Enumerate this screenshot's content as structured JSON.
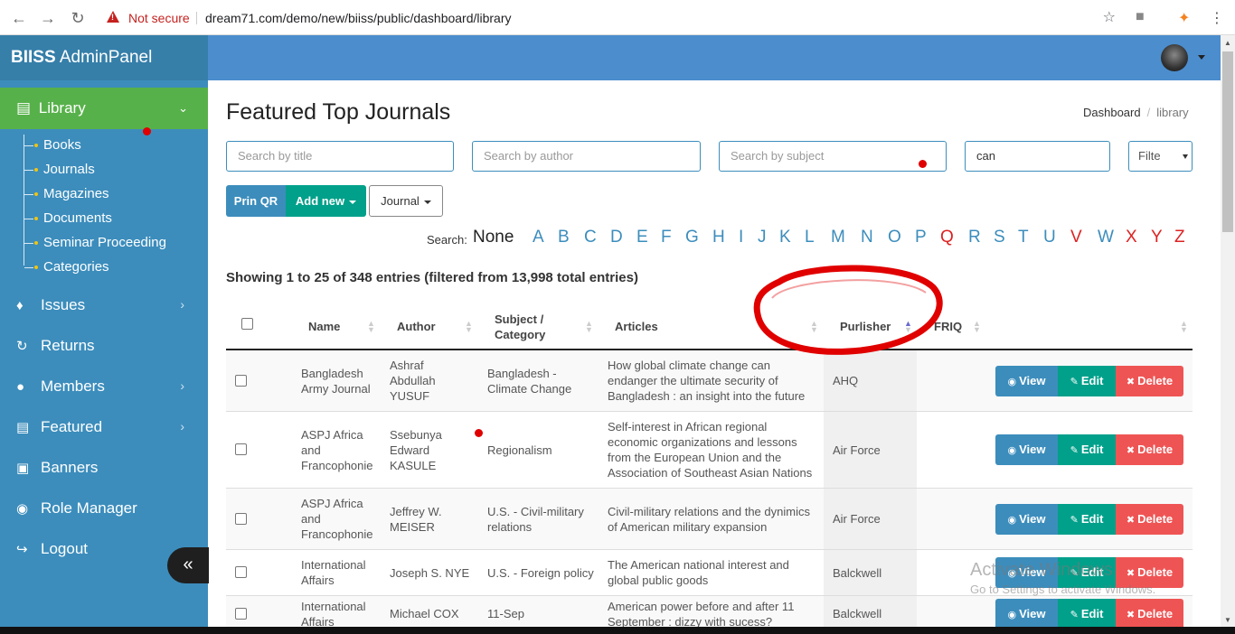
{
  "browser": {
    "security": "Not secure",
    "url": "dream71.com/demo/new/biiss/public/dashboard/library"
  },
  "sidebar": {
    "brand_bold": "BIISS",
    "brand_rest": " AdminPanel",
    "active": {
      "label": "Library",
      "icon": "book-icon"
    },
    "submenu": [
      "Books",
      "Journals",
      "Magazines",
      "Documents",
      "Seminar Proceeding",
      "Categories"
    ],
    "items": [
      {
        "label": "Issues",
        "icon": "diamond-icon",
        "arrow": true
      },
      {
        "label": "Returns",
        "icon": "refresh-icon",
        "arrow": false
      },
      {
        "label": "Members",
        "icon": "users-icon",
        "arrow": true
      },
      {
        "label": "Featured",
        "icon": "list-icon",
        "arrow": true
      },
      {
        "label": "Banners",
        "icon": "image-icon",
        "arrow": false
      },
      {
        "label": "Role Manager",
        "icon": "lock-icon",
        "arrow": false
      },
      {
        "label": "Logout",
        "icon": "sign-out-icon",
        "arrow": false
      }
    ]
  },
  "page": {
    "title": "Featured Top Journals",
    "breadcrumb": [
      "Dashboard",
      "library"
    ]
  },
  "search": {
    "title_placeholder": "Search by title",
    "author_placeholder": "Search by author",
    "subject_placeholder": "Search by subject",
    "value": "can",
    "filter_label": "Filte"
  },
  "buttons": {
    "qr": "Prin QR",
    "add": "Add new",
    "journal": "Journal"
  },
  "alpha": {
    "label": "Search:",
    "none": "None",
    "letters": [
      "A",
      "B",
      "C",
      "D",
      "E",
      "F",
      "G",
      "H",
      "I",
      "J",
      "K",
      "L",
      "M",
      "N",
      "O",
      "P",
      "Q",
      "R",
      "S",
      "T",
      "U",
      "V",
      "W",
      "X",
      "Y",
      "Z"
    ],
    "red_letters": [
      "Q",
      "V",
      "X",
      "Y",
      "Z"
    ]
  },
  "info": "Showing 1 to 25 of 348 entries (filtered from 13,998 total entries)",
  "table": {
    "headers": {
      "name": "Name",
      "author": "Author",
      "subject_1": "Subject /",
      "subject_2": "Category",
      "articles": "Articles",
      "publisher": "Purlisher",
      "friq": "FRIQ"
    },
    "actions": {
      "view": "View",
      "edit": "Edit",
      "delete": "Delete"
    },
    "rows": [
      {
        "name": [
          "Bangladesh",
          "Army Journal"
        ],
        "author": [
          "Ashraf",
          "Abdullah",
          "YUSUF"
        ],
        "subject": [
          "Bangladesh -",
          "Climate Change"
        ],
        "article": [
          "How global climate change can",
          "endanger the ultimate security of",
          "Bangladesh : an insight into the future"
        ],
        "publisher": "AHQ"
      },
      {
        "name": [
          "ASPJ Africa",
          "and",
          "Francophonie"
        ],
        "author": [
          "Ssebunya",
          "Edward",
          "KASULE"
        ],
        "subject": [
          "Regionalism"
        ],
        "article": [
          "Self-interest in African regional",
          "economic organizations and lessons",
          "from the European Union and the",
          "Association of Southeast Asian Nations"
        ],
        "publisher": "Air Force"
      },
      {
        "name": [
          "ASPJ Africa",
          "and",
          "Francophonie"
        ],
        "author": [
          "Jeffrey W.",
          "MEISER"
        ],
        "subject": [
          "U.S. - Civil-military",
          "relations"
        ],
        "article": [
          "Civil-military relations and the dynimics",
          "of American military expansion"
        ],
        "publisher": "Air Force"
      },
      {
        "name": [
          "International",
          "Affairs"
        ],
        "author": [
          "Joseph S. NYE"
        ],
        "subject": [
          "U.S. - Foreign policy"
        ],
        "article": [
          "The American national interest and",
          "global public goods"
        ],
        "publisher": "Balckwell"
      },
      {
        "name": [
          "International",
          "Affairs"
        ],
        "author": [
          "Michael COX"
        ],
        "subject": [
          "11-Sep"
        ],
        "article": [
          "American power before and after 11",
          "September : dizzy with sucess?"
        ],
        "publisher": "Balckwell"
      }
    ]
  },
  "watermark": {
    "line1": "Activate Windows",
    "line2": "Go to Settings to activate Windows."
  },
  "colors": {
    "sidebar": "#3c8dbc",
    "active": "#57b14a",
    "topbar": "#4c8dcd",
    "view": "#3c8dbc",
    "edit": "#00a08a",
    "delete": "#ef5454",
    "annotation": "#e00000"
  }
}
